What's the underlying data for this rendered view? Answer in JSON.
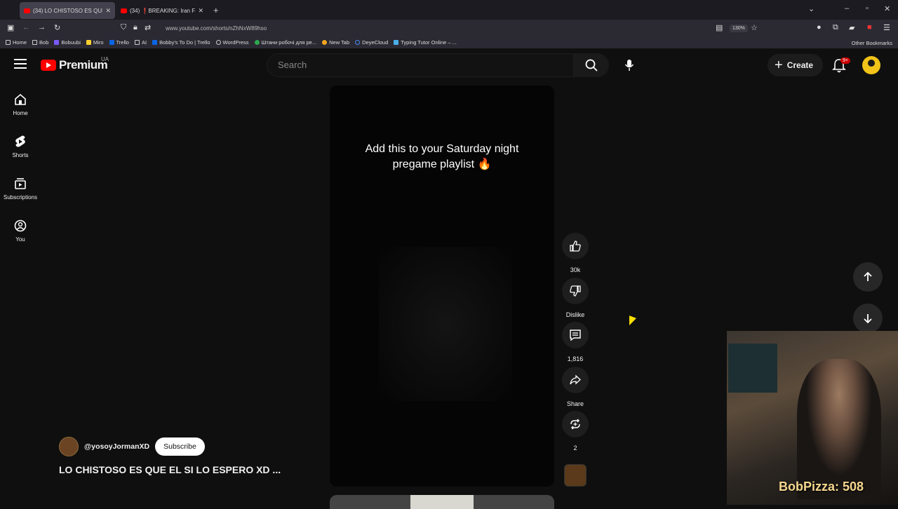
{
  "browser": {
    "tabs": [
      {
        "label": "(34) LO CHISTOSO ES QUE EL"
      },
      {
        "label": "(34) ❗BREAKING: Iran Fire Mi"
      }
    ],
    "url": "www.youtube.com/shorts/nZhNxW89hso",
    "zoom": "130%",
    "bookmarks": [
      "Home",
      "Bob",
      "Bobuubi",
      "Miro",
      "Trello",
      "AI",
      "Bobby's To Do | Trello",
      "WordPress",
      "Штани робочі для ре...",
      "New Tab",
      "DeyeCloud",
      "Typing Tutor Online – ..."
    ],
    "other_bookmarks": "Other Bookmarks"
  },
  "header": {
    "logo": "Premium",
    "region": "UA",
    "search_placeholder": "Search",
    "create_label": "Create",
    "notif_count": "9+"
  },
  "sidebar": {
    "items": [
      {
        "label": "Home"
      },
      {
        "label": "Shorts"
      },
      {
        "label": "Subscriptions"
      },
      {
        "label": "You"
      }
    ]
  },
  "short": {
    "caption": "Add this to your Saturday night pregame playlist 🔥",
    "channel": "@yosoyJormanXD",
    "subscribe_label": "Subscribe",
    "title": "LO CHISTOSO ES QUE EL SI LO ESPERO XD ...",
    "likes": "30k",
    "dislike_label": "Dislike",
    "comments": "1,816",
    "share_label": "Share",
    "remix_count": "2"
  },
  "webcam": {
    "overlay": "BobPizza: 508"
  },
  "colors": {
    "accent": "#ff0000",
    "background": "#0f0f0f"
  }
}
